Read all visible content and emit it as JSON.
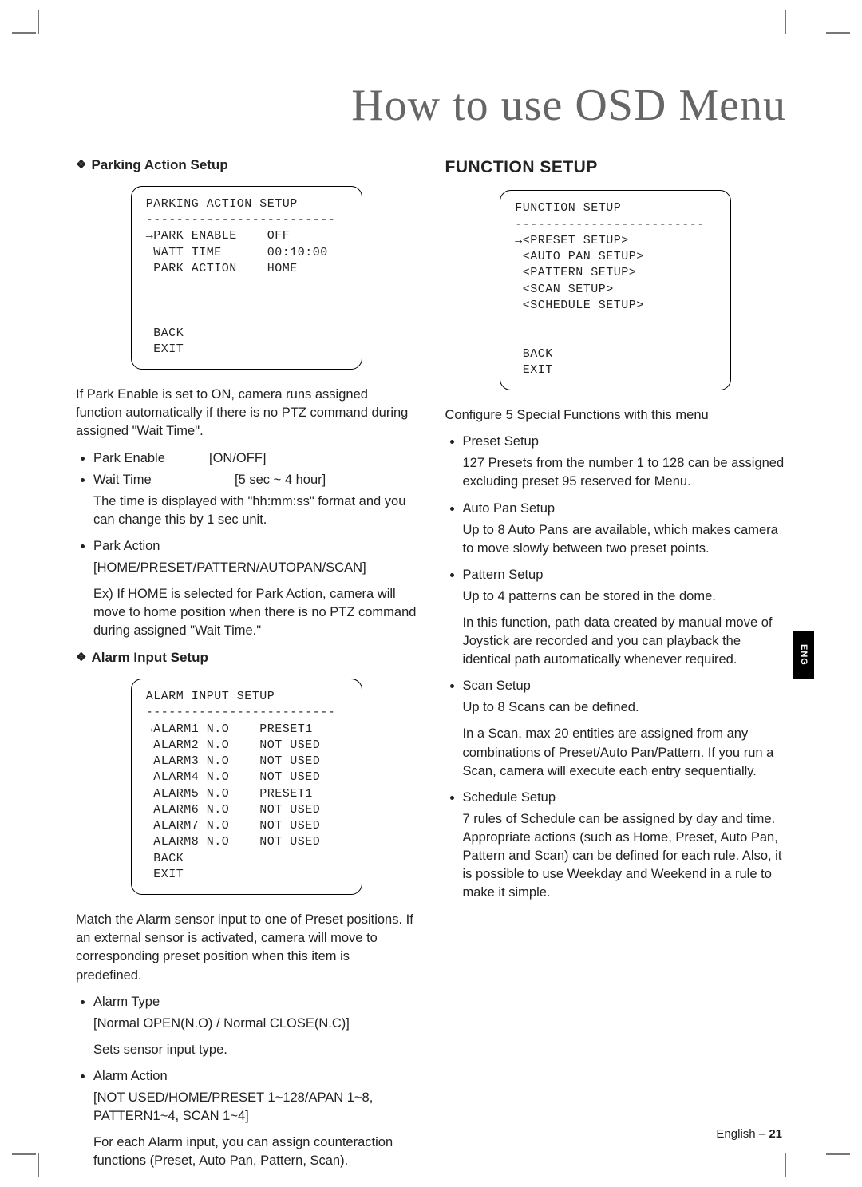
{
  "page_title": "How to use OSD Menu",
  "side_tab": "ENG",
  "footer_lang": "English –",
  "footer_page": "21",
  "left": {
    "parking": {
      "heading": "Parking Action Setup",
      "osd_title": "PARKING ACTION SETUP",
      "osd_sep": "-------------------------",
      "osd_l1_label": "→PARK ENABLE",
      "osd_l1_val": "OFF",
      "osd_l2_label": " WATT TIME",
      "osd_l2_val": "00:10:00",
      "osd_l3_label": " PARK ACTION",
      "osd_l3_val": "HOME",
      "osd_back": " BACK",
      "osd_exit": " EXIT",
      "para1": "If Park Enable is set to ON, camera runs assigned function automatically if there is no PTZ command during assigned \"Wait Time\".",
      "b1_label": "Park Enable",
      "b1_val": "[ON/OFF]",
      "b2_label": "Wait Time",
      "b2_val": "[5 sec ~ 4 hour]",
      "b2_desc": "The time is displayed with \"hh:mm:ss\" format and you can change this by 1 sec unit.",
      "b3_label": "Park Action",
      "b3_val": "[HOME/PRESET/PATTERN/AUTOPAN/SCAN]",
      "b3_desc": "Ex) If HOME is selected for Park Action, camera will move to home position when there is no PTZ command during assigned \"Wait Time.\""
    },
    "alarm": {
      "heading": "Alarm Input Setup",
      "osd_title": "ALARM INPUT SETUP",
      "osd_sep": "-------------------------",
      "rows": [
        {
          "label": "→ALARM1 N.O",
          "val": "PRESET1"
        },
        {
          "label": " ALARM2 N.O",
          "val": "NOT USED"
        },
        {
          "label": " ALARM3 N.O",
          "val": "NOT USED"
        },
        {
          "label": " ALARM4 N.O",
          "val": "NOT USED"
        },
        {
          "label": " ALARM5 N.O",
          "val": "PRESET1"
        },
        {
          "label": " ALARM6 N.O",
          "val": "NOT USED"
        },
        {
          "label": " ALARM7 N.O",
          "val": "NOT USED"
        },
        {
          "label": " ALARM8 N.O",
          "val": "NOT USED"
        }
      ],
      "osd_back": " BACK",
      "osd_exit": " EXIT",
      "para1": "Match the Alarm sensor input to one of Preset positions. If an external sensor is activated, camera will move to corresponding preset position when this item is predefined.",
      "b1_label": "Alarm Type",
      "b1_val": "[Normal OPEN(N.O) / Normal CLOSE(N.C)]",
      "b1_desc": "Sets sensor input type.",
      "b2_label": "Alarm Action",
      "b2_val": "[NOT USED/HOME/PRESET 1~128/APAN 1~8, PATTERN1~4, SCAN 1~4]",
      "b2_desc": "For each Alarm input, you can assign counteraction functions (Preset, Auto Pan, Pattern, Scan)."
    }
  },
  "right": {
    "heading": "FUNCTION SETUP",
    "osd_title": "FUNCTION SETUP",
    "osd_sep": "-------------------------",
    "osd_lines": [
      "→<PRESET SETUP>",
      " <AUTO PAN SETUP>",
      " <PATTERN SETUP>",
      " <SCAN SETUP>",
      " <SCHEDULE SETUP>"
    ],
    "osd_back": " BACK",
    "osd_exit": " EXIT",
    "para1": "Configure 5 Special Functions with this menu",
    "b1_label": "Preset Setup",
    "b1_desc": "127 Presets from the number 1 to 128 can be assigned excluding preset 95 reserved for Menu.",
    "b2_label": "Auto Pan Setup",
    "b2_desc": "Up to 8 Auto Pans are available, which makes camera to move slowly between two preset points.",
    "b3_label": "Pattern Setup",
    "b3_desc1": "Up to 4 patterns can be stored in the dome.",
    "b3_desc2": "In this function, path data created by manual move of Joystick are recorded and you can playback the identical path automatically whenever required.",
    "b4_label": "Scan Setup",
    "b4_desc1": "Up to 8 Scans can be defined.",
    "b4_desc2": "In a Scan, max 20 entities are assigned from any combinations of Preset/Auto Pan/Pattern. If you run a Scan, camera will execute each entry sequentially.",
    "b5_label": "Schedule Setup",
    "b5_desc": "7 rules of Schedule can be assigned by day and time. Appropriate actions (such as Home, Preset, Auto Pan, Pattern and Scan) can be defined for each rule. Also, it is possible to use Weekday and Weekend in a rule to make it simple."
  }
}
